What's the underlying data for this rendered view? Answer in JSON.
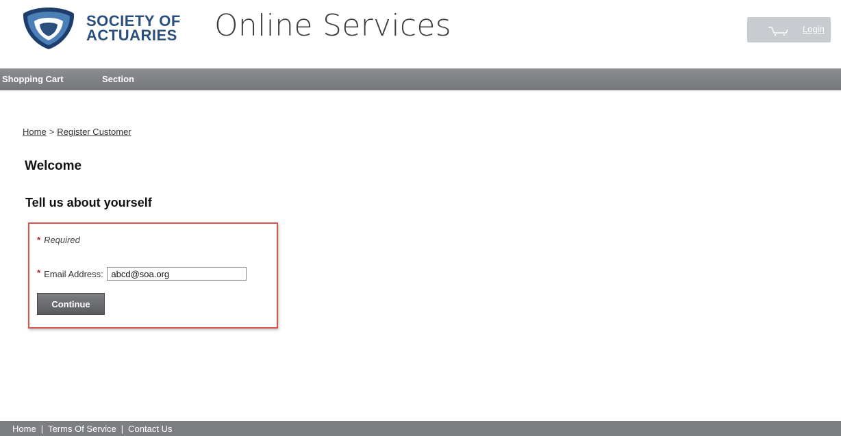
{
  "header": {
    "brand_line1": "SOCIETY OF",
    "brand_line2": "ACTUARIES",
    "site_title": "Online Services",
    "login_label": "Login",
    "cart_icon": "shopping-cart-icon",
    "logo_icon": "shield-logo-icon"
  },
  "nav": {
    "items": [
      {
        "label": "Shopping Cart"
      },
      {
        "label": "Section"
      }
    ]
  },
  "breadcrumb": {
    "home": "Home",
    "separator": ">",
    "current": "Register Customer"
  },
  "main": {
    "welcome": "Welcome",
    "subtitle": "Tell us about yourself"
  },
  "form": {
    "required_marker": "*",
    "required_text": "Required",
    "email_label": "Email Address:",
    "email_value": "abcd@soa.org",
    "continue_label": "Continue"
  },
  "footer": {
    "links": [
      {
        "label": "Home"
      },
      {
        "label": "Terms Of Service"
      },
      {
        "label": "Contact Us"
      }
    ],
    "separator": "|"
  },
  "colors": {
    "brand_blue": "#2a4e7d",
    "nav_gray": "#808286",
    "required_red": "#b22222",
    "highlight_border": "#d9534f"
  }
}
